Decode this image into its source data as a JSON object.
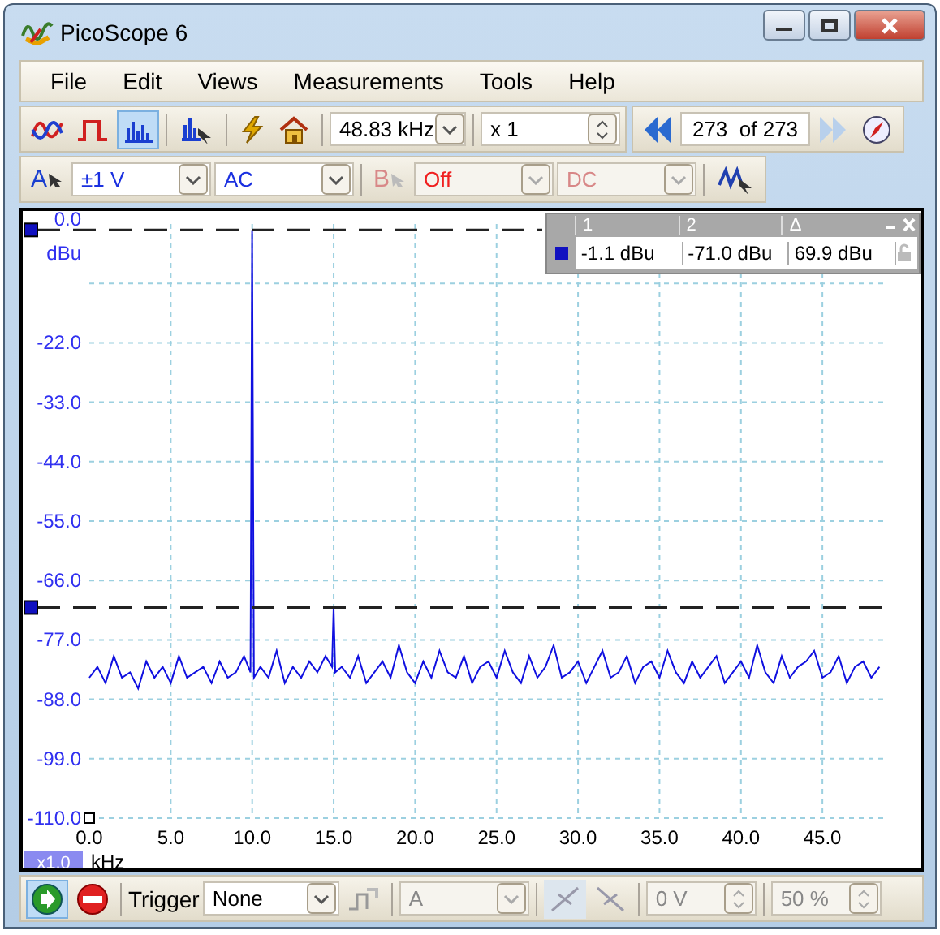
{
  "window": {
    "title": "PicoScope 6"
  },
  "menu": [
    "File",
    "Edit",
    "Views",
    "Measurements",
    "Tools",
    "Help"
  ],
  "toolbar": {
    "view_buttons": [
      {
        "kind": "scope",
        "selected": false
      },
      {
        "kind": "persistence",
        "selected": false
      },
      {
        "kind": "spectrum",
        "selected": true
      }
    ],
    "frequency": "48.83 kHz",
    "zoom": "x 1",
    "buffer": "273  of 273"
  },
  "channels": [
    {
      "label": "A",
      "range": "±1 V",
      "coupling": "AC",
      "disabled": false
    },
    {
      "label": "B",
      "range": "Off",
      "coupling": "DC",
      "disabled": true
    }
  ],
  "plot": {
    "zoom_badge": "x1.0",
    "chart_data": {
      "type": "line",
      "xlabel": "kHz",
      "ylabel": "dBu",
      "xlim": [
        0,
        48.83
      ],
      "ylim": [
        -110,
        0
      ],
      "grid": true,
      "ref_lines": [
        {
          "axis": "y",
          "value": -1.1
        },
        {
          "axis": "y",
          "value": -71
        }
      ],
      "xticks": [
        {
          "value": 0,
          "label": "0.0"
        },
        {
          "value": 5,
          "label": "5.0"
        },
        {
          "value": 10,
          "label": "10.0"
        },
        {
          "value": 15,
          "label": "15.0"
        },
        {
          "value": 20,
          "label": "20.0"
        },
        {
          "value": 25,
          "label": "25.0"
        },
        {
          "value": 30,
          "label": "30.0"
        },
        {
          "value": 35,
          "label": "35.0"
        },
        {
          "value": 40,
          "label": "40.0"
        },
        {
          "value": 45,
          "label": "45.0"
        }
      ],
      "yticks": [
        {
          "value": 0,
          "label": "0.0"
        },
        {
          "value": -22,
          "label": "-22.0"
        },
        {
          "value": -33,
          "label": "-33.0"
        },
        {
          "value": -44,
          "label": "-44.0"
        },
        {
          "value": -55,
          "label": "-55.0"
        },
        {
          "value": -66,
          "label": "-66.0"
        },
        {
          "value": -77,
          "label": "-77.0"
        },
        {
          "value": -88,
          "label": "-88.0"
        },
        {
          "value": -99,
          "label": "-99.0"
        },
        {
          "value": -110,
          "label": "-110.0"
        }
      ],
      "x": [
        0,
        0.5,
        1,
        1.5,
        2,
        2.5,
        3,
        3.5,
        4,
        4.5,
        5,
        5.5,
        6,
        6.5,
        7,
        7.5,
        8,
        8.5,
        9,
        9.5,
        9.9,
        10,
        10.1,
        10.5,
        11,
        11.5,
        12,
        12.5,
        13,
        13.5,
        14,
        14.5,
        14.9,
        15,
        15.1,
        15.5,
        16,
        16.5,
        17,
        17.5,
        18,
        18.5,
        19,
        19.5,
        20,
        20.5,
        21,
        21.5,
        22,
        22.5,
        23,
        23.5,
        24,
        24.5,
        25,
        25.5,
        26,
        26.5,
        27,
        27.5,
        28,
        28.5,
        29,
        29.5,
        30,
        30.5,
        31,
        31.5,
        32,
        32.5,
        33,
        33.5,
        34,
        34.5,
        35,
        35.5,
        36,
        36.5,
        37,
        37.5,
        38,
        38.5,
        39,
        39.5,
        40,
        40.5,
        41,
        41.5,
        42,
        42.5,
        43,
        43.5,
        44,
        44.5,
        45,
        45.5,
        46,
        46.5,
        47,
        47.5,
        48,
        48.5
      ],
      "series": [
        {
          "color": "#1010e0",
          "values": [
            -84,
            -82,
            -85,
            -80,
            -84,
            -83,
            -86,
            -81,
            -84,
            -82,
            -85,
            -80,
            -84,
            -83,
            -82,
            -85,
            -81,
            -84,
            -83,
            -80,
            -83,
            -1.1,
            -84,
            -82,
            -84,
            -79,
            -85,
            -82,
            -84,
            -81,
            -83,
            -80,
            -82,
            -71,
            -83,
            -82,
            -84,
            -80,
            -85,
            -83,
            -81,
            -84,
            -78,
            -83,
            -85,
            -81,
            -84,
            -79,
            -83,
            -84,
            -80,
            -85,
            -82,
            -81,
            -84,
            -79,
            -83,
            -85,
            -80,
            -84,
            -82,
            -78,
            -84,
            -83,
            -81,
            -85,
            -82,
            -79,
            -84,
            -83,
            -80,
            -85,
            -82,
            -81,
            -84,
            -79,
            -83,
            -85,
            -81,
            -84,
            -82,
            -80,
            -85,
            -83,
            -81,
            -84,
            -78,
            -83,
            -85,
            -80,
            -84,
            -82,
            -81,
            -79,
            -84,
            -83,
            -80,
            -85,
            -82,
            -81,
            -84,
            -82
          ]
        }
      ]
    }
  },
  "rulers": {
    "headers": [
      "1",
      "2",
      "Δ"
    ],
    "values": [
      "-1.1 dBu",
      "-71.0 dBu",
      "69.9 dBu"
    ]
  },
  "bottom": {
    "running": true,
    "trigger_label": "Trigger",
    "trigger_mode": "None",
    "source": "A",
    "threshold": "0 V",
    "pretrigger": "50 %"
  }
}
